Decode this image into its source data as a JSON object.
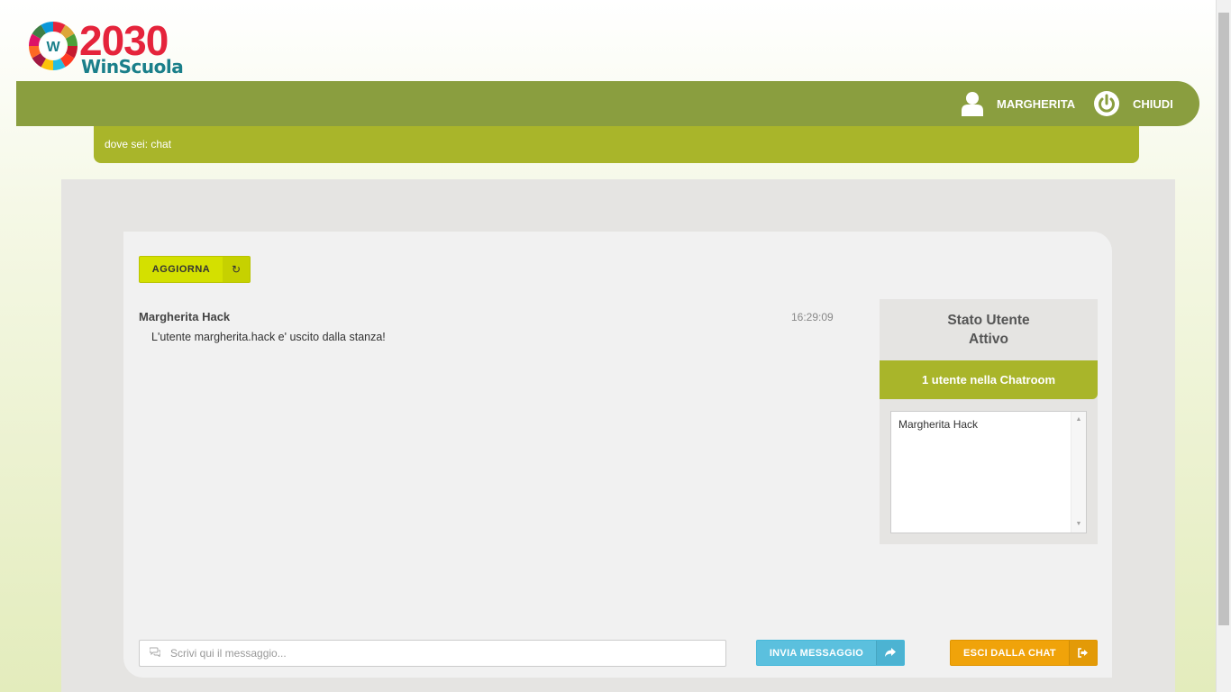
{
  "logo": {
    "year": "2030",
    "brand": "WinScuola",
    "wheel_letter": "W"
  },
  "navbar": {
    "user_label": "MARGHERITA",
    "close_label": "CHIUDI"
  },
  "breadcrumb": {
    "text": "dove sei: chat"
  },
  "toolbar": {
    "refresh_label": "AGGIORNA",
    "refresh_icon": "refresh-icon"
  },
  "messages": [
    {
      "author": "Margherita Hack",
      "time": "16:29:09",
      "text": "L'utente margherita.hack e' uscito dalla stanza!"
    }
  ],
  "status": {
    "title_line1": "Stato Utente",
    "title_line2": "Attivo",
    "users_count": "1 utente nella Chatroom",
    "users": [
      "Margherita Hack"
    ]
  },
  "composer": {
    "placeholder": "Scrivi qui il messaggio...",
    "send_label": "INVIA MESSAGGIO",
    "exit_label": "ESCI DALLA CHAT"
  },
  "colors": {
    "navbar": "#8a9e3f",
    "breadcrumb": "#a9b52a",
    "refresh": "#d4e000",
    "send": "#5bc0de",
    "exit": "#f0a30a"
  }
}
